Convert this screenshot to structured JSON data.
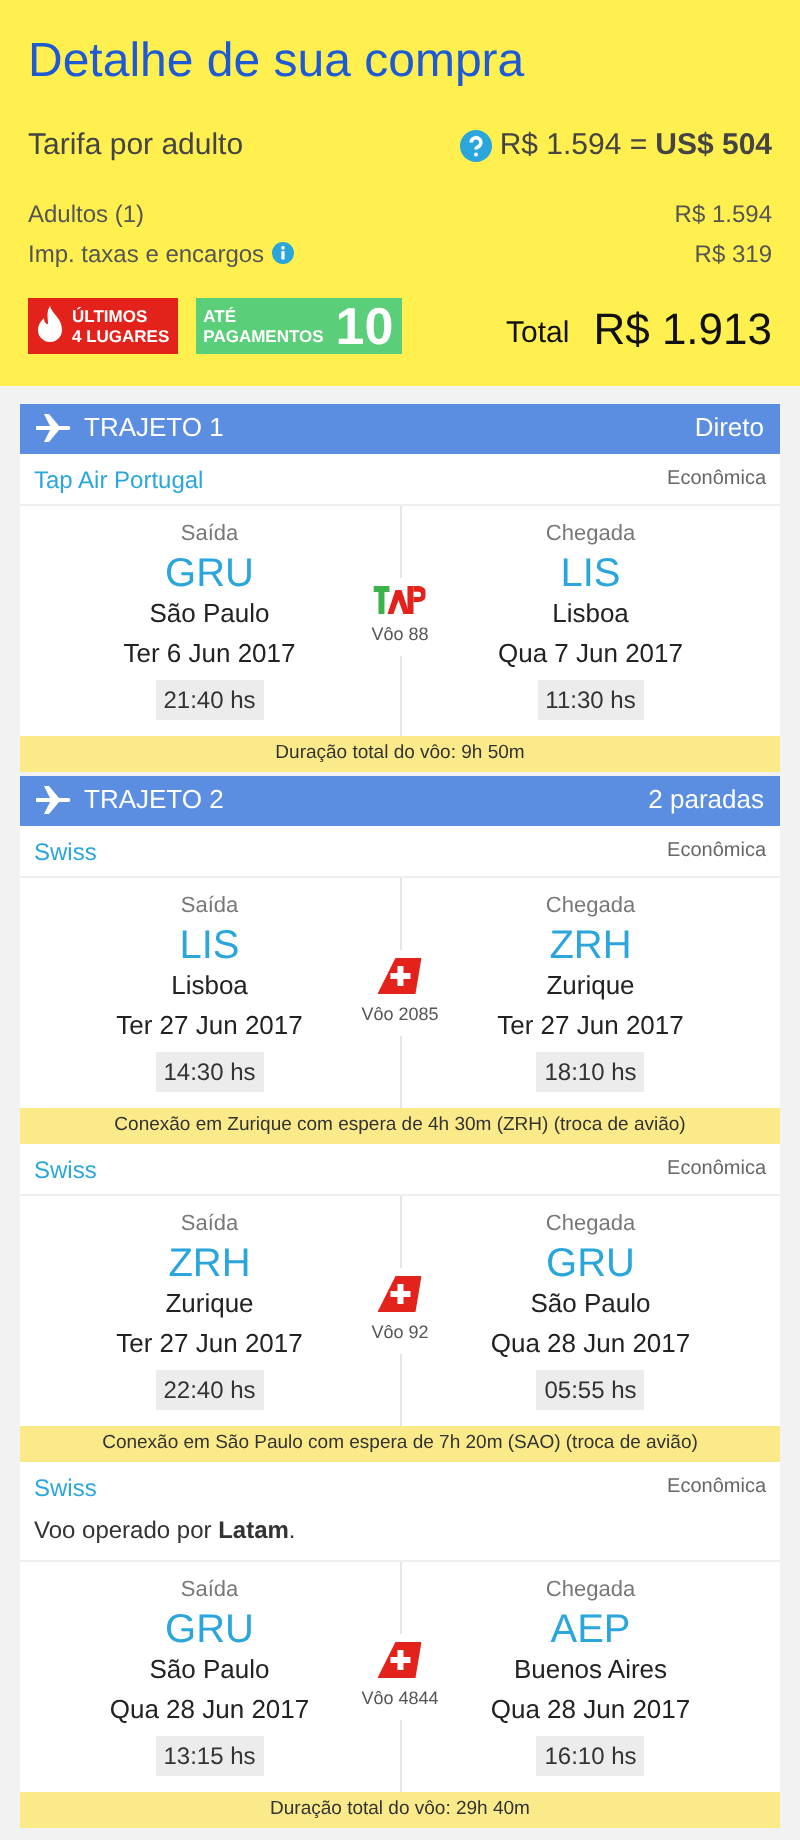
{
  "summary": {
    "title": "Detalhe de sua compra",
    "fare_label": "Tarifa por adulto",
    "fare_local": "R$ 1.594 =",
    "fare_usd": "US$ 504",
    "lines": [
      {
        "label": "Adultos (1)",
        "value": "R$ 1.594",
        "info": false
      },
      {
        "label": "Imp. taxas e encargos",
        "value": "R$ 319",
        "info": true
      }
    ],
    "badges": [
      {
        "kind": "seats",
        "line1": "ÚLTIMOS",
        "line2": "4 LUGARES"
      },
      {
        "kind": "installments",
        "line1": "ATÉ",
        "line2": "PAGAMENTOS",
        "number": "10"
      }
    ],
    "total_label": "Total",
    "total_value": "R$ 1.913"
  },
  "routes": [
    {
      "title": "TRAJETO 1",
      "stops": "Direto",
      "legs": [
        {
          "airline": "Tap Air Portugal",
          "cabin": "Econômica",
          "kind": "tap",
          "flight": "Vôo 88",
          "departure": {
            "label": "Saída",
            "code": "GRU",
            "city": "São Paulo",
            "date": "Ter 6 Jun 2017",
            "time": "21:40 hs"
          },
          "arrival": {
            "label": "Chegada",
            "code": "LIS",
            "city": "Lisboa",
            "date": "Qua 7 Jun 2017",
            "time": "11:30 hs"
          }
        }
      ],
      "duration": "Duração total do vôo: 9h 50m"
    },
    {
      "title": "TRAJETO 2",
      "stops": "2 paradas",
      "legs": [
        {
          "airline": "Swiss",
          "cabin": "Econômica",
          "kind": "swiss",
          "flight": "Vôo 2085",
          "departure": {
            "label": "Saída",
            "code": "LIS",
            "city": "Lisboa",
            "date": "Ter 27 Jun 2017",
            "time": "14:30 hs"
          },
          "arrival": {
            "label": "Chegada",
            "code": "ZRH",
            "city": "Zurique",
            "date": "Ter 27 Jun 2017",
            "time": "18:10 hs"
          },
          "connection": "Conexão em Zurique com espera de 4h 30m (ZRH) (troca de avião)"
        },
        {
          "airline": "Swiss",
          "cabin": "Econômica",
          "kind": "swiss",
          "flight": "Vôo 92",
          "departure": {
            "label": "Saída",
            "code": "ZRH",
            "city": "Zurique",
            "date": "Ter 27 Jun 2017",
            "time": "22:40 hs"
          },
          "arrival": {
            "label": "Chegada",
            "code": "GRU",
            "city": "São Paulo",
            "date": "Qua 28 Jun 2017",
            "time": "05:55 hs"
          },
          "connection": "Conexão em São Paulo com espera de 7h 20m (SAO) (troca de avião)"
        },
        {
          "airline": "Swiss",
          "cabin": "Econômica",
          "kind": "swiss",
          "flight": "Vôo 4844",
          "operated_by": "Voo operado por **Latam**.",
          "departure": {
            "label": "Saída",
            "code": "GRU",
            "city": "São Paulo",
            "date": "Qua 28 Jun 2017",
            "time": "13:15 hs"
          },
          "arrival": {
            "label": "Chegada",
            "code": "AEP",
            "city": "Buenos Aires",
            "date": "Qua 28 Jun 2017",
            "time": "16:10 hs"
          }
        }
      ],
      "duration": "Duração total do vôo: 29h 40m"
    }
  ]
}
